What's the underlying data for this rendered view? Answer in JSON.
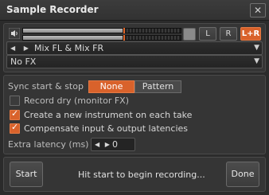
{
  "window": {
    "title": "Sample Recorder",
    "close_glyph": "✕"
  },
  "monitor": {
    "speaker_icon": "speaker-icon",
    "meter_top_level": 0.64,
    "meter_bottom_level": 0.64,
    "channels": [
      "L",
      "R",
      "L+R"
    ],
    "active_channel": "L+R"
  },
  "input_source": {
    "arrows": "◀ ▶",
    "value": "Mix FL & Mix FR",
    "caret": "▼"
  },
  "fx_chain": {
    "value": "No FX",
    "caret": "▼"
  },
  "options": {
    "sync_label": "Sync start & stop",
    "sync_options": [
      "None",
      "Pattern"
    ],
    "sync_selected": "None",
    "checkboxes": [
      {
        "label": "Record dry (monitor FX)",
        "checked": false
      },
      {
        "label": "Create a new instrument on each take",
        "checked": true
      },
      {
        "label": "Compensate input & output latencies",
        "checked": true
      }
    ],
    "check_glyph": "✓",
    "extra_latency_label": "Extra latency (ms)",
    "extra_latency_arrows": "◀ ▶",
    "extra_latency_value": "0"
  },
  "footer": {
    "start_label": "Start",
    "status_text": "Hit start to begin recording...",
    "done_label": "Done"
  },
  "colors": {
    "accent": "#d9622b",
    "background": "#2b2b2b"
  }
}
